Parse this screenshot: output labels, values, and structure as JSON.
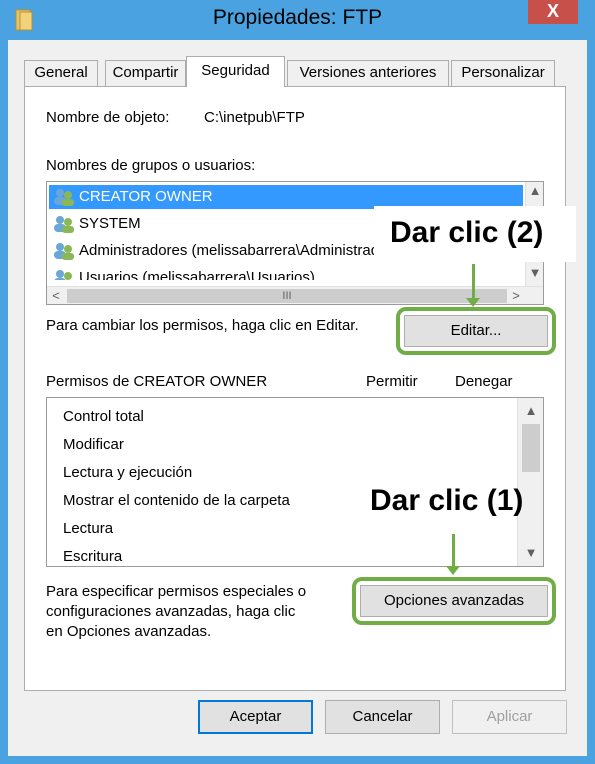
{
  "window": {
    "title": "Propiedades: FTP",
    "close_symbol": "X"
  },
  "tabs": [
    {
      "label": "General"
    },
    {
      "label": "Compartir"
    },
    {
      "label": "Seguridad"
    },
    {
      "label": "Versiones anteriores"
    },
    {
      "label": "Personalizar"
    }
  ],
  "security": {
    "object_name_label": "Nombre de objeto:",
    "object_name_value": "C:\\inetpub\\FTP",
    "groups_label": "Nombres de grupos o usuarios:",
    "groups": [
      {
        "name": "CREATOR OWNER",
        "selected": true
      },
      {
        "name": "SYSTEM",
        "selected": false
      },
      {
        "name": "Administradores (melissabarrera\\Administradores)",
        "selected": false
      },
      {
        "name": "Usuarios (melissabarrera\\Usuarios)",
        "selected": false
      }
    ],
    "change_perm_text": "Para cambiar los permisos, haga clic en Editar.",
    "edit_button": "Editar...",
    "permissions_for_label": "Permisos de CREATOR OWNER",
    "allow_header": "Permitir",
    "deny_header": "Denegar",
    "permissions": [
      {
        "name": "Control total"
      },
      {
        "name": "Modificar"
      },
      {
        "name": "Lectura y ejecución"
      },
      {
        "name": "Mostrar el contenido de la carpeta"
      },
      {
        "name": "Lectura"
      },
      {
        "name": "Escritura"
      }
    ],
    "advanced_text": [
      "Para especificar permisos especiales o",
      "configuraciones avanzadas, haga clic",
      "en Opciones avanzadas."
    ],
    "advanced_button": "Opciones avanzadas",
    "hscroll_grip": "III"
  },
  "footer": {
    "accept_button": "Aceptar",
    "cancel_button": "Cancelar",
    "apply_button": "Aplicar"
  },
  "annotations": {
    "callout_1": "Dar clic (1)",
    "callout_2": "Dar clic (2)",
    "highlight_color": "#70ad47"
  },
  "colors": {
    "title_bar": "#4aa3e0",
    "close_button": "#c7504a",
    "selection": "#3399ff"
  },
  "icons": {
    "folder": "folder-icon",
    "user_group": "user-group-icon",
    "scroll_up": "▲",
    "scroll_down": "▼",
    "scroll_left": "<",
    "scroll_right": ">"
  }
}
